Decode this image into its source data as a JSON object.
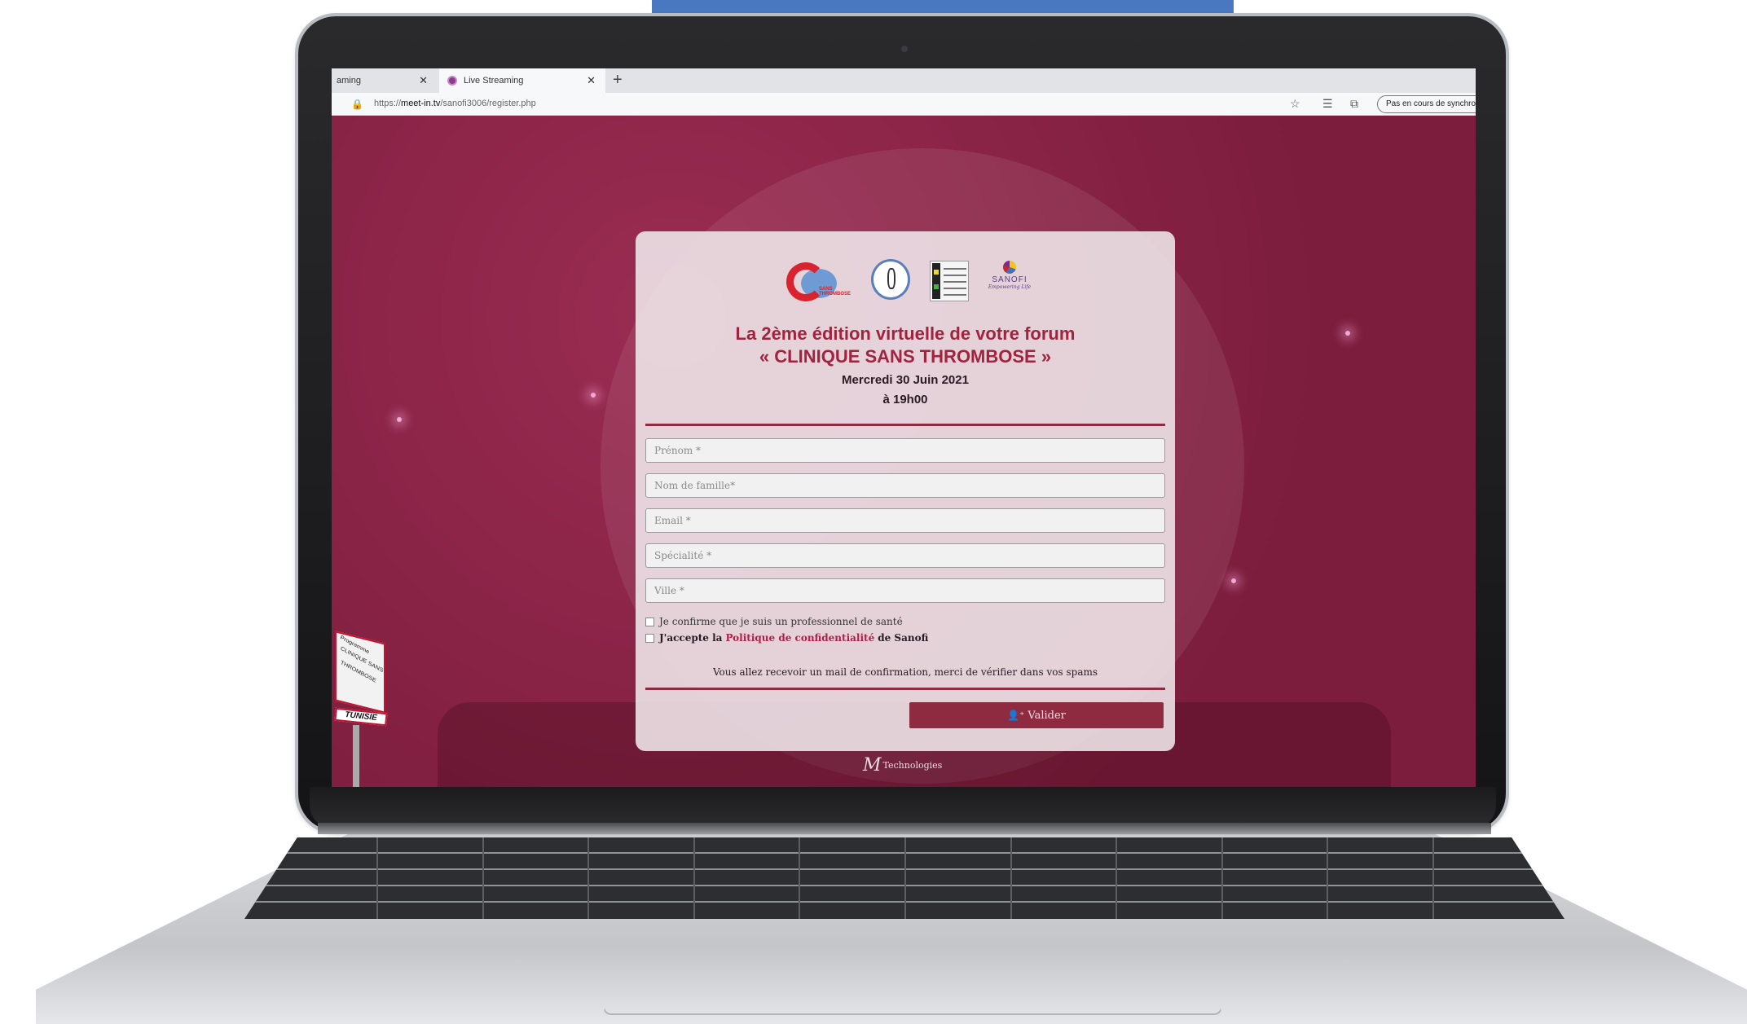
{
  "browser": {
    "tabs": [
      {
        "label": "aming",
        "close": "✕",
        "active": false
      },
      {
        "label": "Live Streaming",
        "close": "✕",
        "active": true
      }
    ],
    "new_tab_icon": "+",
    "url_prefix": "https://",
    "url_host": "meet-in.tv",
    "url_path": "/sanofi3006/register.php",
    "sync_label": "Pas en cours de synchro"
  },
  "icons": {
    "lock": "lock-icon",
    "favorites": "star-add-icon",
    "collections": "collections-icon",
    "tabs": "tab-actions-icon",
    "user": "user-plus-icon"
  },
  "form": {
    "logos": {
      "c_logo_text": "SANS THROMBOSE",
      "sanofi_name": "SANOFI",
      "sanofi_tag": "Empowering Life"
    },
    "heading_line1": "La 2ème édition virtuelle de votre forum",
    "heading_line2": "« CLINIQUE SANS THROMBOSE »",
    "date": "Mercredi 30 Juin 2021",
    "time": "à 19h00",
    "fields": {
      "first_name": "Prénom *",
      "last_name": "Nom de famille*",
      "email": "Email *",
      "specialty": "Spécialité *",
      "city": "Ville *"
    },
    "confirm_professional": "Je confirme que je suis un professionnel de santé",
    "accept_prefix": "J'accepte la",
    "accept_link": "Politique de confidentialité",
    "accept_suffix": "de Sanofi",
    "notice": "Vous allez recevoir un mail de confirmation, merci de vérifier dans vos spams",
    "submit_label": "Valider"
  },
  "sign": {
    "line1": "Programme",
    "line2": "CLINIQUE SANS",
    "line3": "THROMBOSE",
    "country": "TUNISIE"
  },
  "footer": {
    "brand": "Technologies"
  },
  "colors": {
    "page_bg": "#8a2345",
    "accent": "#8f2b41",
    "heading": "#a0243f",
    "link": "#b21e46",
    "frame_blue": "#4a78c0"
  }
}
